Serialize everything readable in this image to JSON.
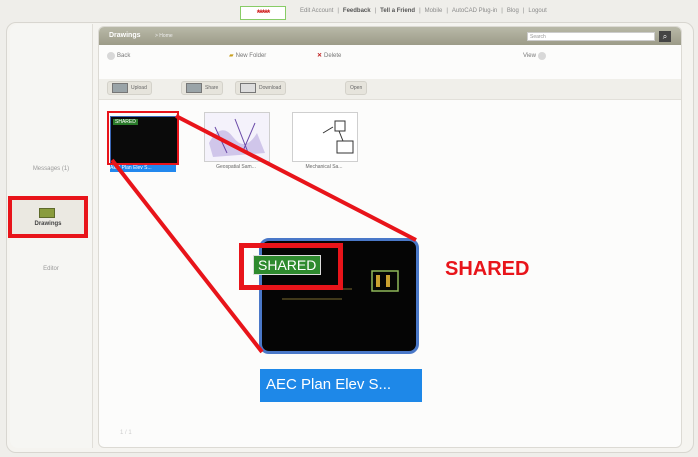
{
  "topbar": {
    "stars": "*****",
    "links": [
      "Edit Account",
      "Feedback",
      "Tell a Friend",
      "Mobile",
      "AutoCAD Plug-in",
      "Blog",
      "Logout"
    ]
  },
  "sidebar": {
    "items": [
      {
        "label": "Messages (1)"
      },
      {
        "label": "Drawings"
      },
      {
        "label": "Editor"
      }
    ]
  },
  "main": {
    "title": "Drawings",
    "subtitle": "> Home",
    "search": {
      "placeholder": "Search"
    },
    "toolbar1": [
      "Back",
      "New Folder",
      "Delete",
      "View"
    ],
    "toolbar2": [
      "Upload",
      "Share",
      "Download",
      "Open"
    ]
  },
  "thumbnails": [
    {
      "label": "AEC Plan Elev S...",
      "shared_label": "SHARED"
    },
    {
      "label": "Geospatial Sam..."
    },
    {
      "label": "Mechanical Sa..."
    }
  ],
  "callout": {
    "shared_label": "SHARED",
    "selected_label": "AEC Plan Elev S...",
    "annotation": "SHARED"
  },
  "pager": {
    "text": "1 / 1"
  },
  "colors": {
    "accent_red": "#e8141a",
    "selection_blue": "#1e88e8",
    "shared_green": "#2e8a2e"
  }
}
